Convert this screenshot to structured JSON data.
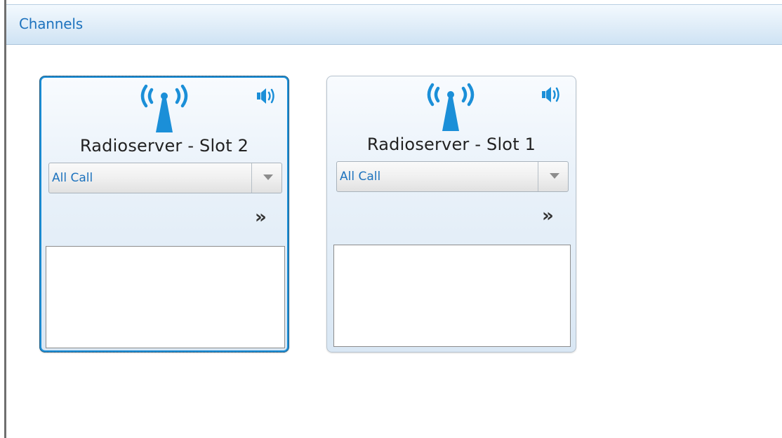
{
  "panel": {
    "title": "Channels"
  },
  "channels": [
    {
      "name": "Radioserver - Slot 2",
      "selected_talkgroup": "All Call",
      "antenna_icon": "radio-tower-icon",
      "speaker_icon": "speaker-icon",
      "expand_icon": "double-chevron-right-icon",
      "expand_glyph": "»",
      "selected": true
    },
    {
      "name": "Radioserver - Slot 1",
      "selected_talkgroup": "All Call",
      "antenna_icon": "radio-tower-icon",
      "speaker_icon": "speaker-icon",
      "expand_icon": "double-chevron-right-icon",
      "expand_glyph": "»",
      "selected": false
    }
  ],
  "colors": {
    "accent": "#1b8fd8",
    "header_text": "#1e73be",
    "icon_blue": "#1b8fd8"
  }
}
